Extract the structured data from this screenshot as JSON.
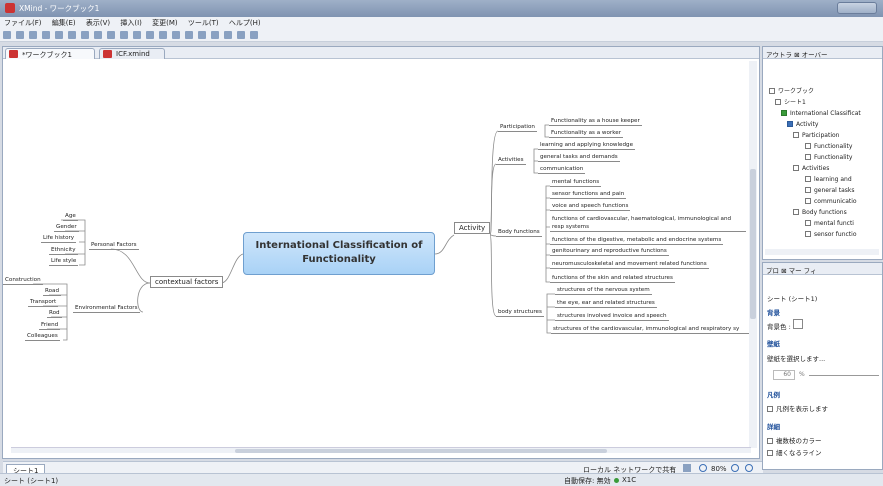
{
  "window": {
    "title": "XMind - ワークブック1"
  },
  "menu": [
    "ファイル(F)",
    "編集(E)",
    "表示(V)",
    "挿入(I)",
    "変更(M)",
    "ツール(T)",
    "ヘルプ(H)"
  ],
  "editor_tabs": [
    "*ワークブック1",
    "ICF.xmind"
  ],
  "map": {
    "central": "International Classification of Functionality",
    "activity": "Activity",
    "contextual": "contextual factors",
    "personal": "Personal Factors",
    "environmental": "Environmental Factors",
    "personal_items": [
      "Age",
      "Gender",
      "Life history",
      "Ethnicity",
      "Life style"
    ],
    "environmental_items": [
      "Construction",
      "Road",
      "Transport",
      "Rod",
      "Friend",
      "Colleagues"
    ],
    "participation": "Participation",
    "participation_items": [
      "Functionality as a house keeper",
      "Functionality as a worker"
    ],
    "activities": "Activities",
    "activities_items": [
      "learning and applying knowledge",
      "general tasks and demands",
      "communication"
    ],
    "body_functions": "Body functions",
    "body_functions_items": [
      "mental functions",
      "sensor functions and pain",
      "voice and speech functions",
      "functions of cardiovascular, haematological, immunological and resp systems",
      "functions of the digestive, metabolic and endocrine systems",
      "genitourinary and reproductive functions",
      "neuromusculoskeletal and movement related functions",
      "functions of the skin and related structures"
    ],
    "body_structures": "body structures",
    "body_structures_items": [
      "structures of the nervous system",
      "the eye, ear and related structures",
      "structures involved invoice and speech",
      "structures of the cardiovascular, immunological and respiratory sy"
    ]
  },
  "sheetbar": {
    "sheet_tab": "シート1",
    "share": "ローカル ネットワークで共有",
    "zoom": "80%"
  },
  "status": {
    "left": "シート (シート1)",
    "autosave": "自動保存: 無効",
    "code": "X1C"
  },
  "outline": {
    "tabs": "アウトラ ⊠  オーバー",
    "items": [
      "ワークブック",
      "シート1",
      "International Classificat",
      "Activity",
      "Participation",
      "Functionality",
      "Functionality",
      "Activities",
      "learning and",
      "general tasks",
      "communicatio",
      "Body functions",
      "mental functi",
      "sensor functio"
    ]
  },
  "props": {
    "tabs": "プロ ⊠  マー  フィ",
    "heading": "シート (シート1)",
    "sec_bg": "背景",
    "bg_color": "背景色 :",
    "sec_wall": "壁紙",
    "wall_select": "壁紙を選択します...",
    "opacity": "60",
    "opacity_unit": "%",
    "sec_legend": "凡例",
    "show_legend": "凡例を表示します",
    "sec_detail": "詳細",
    "multi_color": "複数枝のカラー",
    "taper": "細くなるライン"
  }
}
